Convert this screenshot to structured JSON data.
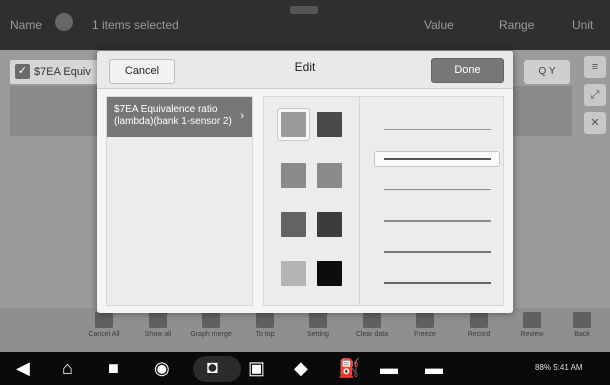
{
  "header": {
    "name_label": "Name",
    "selection_text": "1 items selected",
    "col_value": "Value",
    "col_range": "Range",
    "col_unit": "Unit"
  },
  "background": {
    "item_label": "$7EA Equiv",
    "zoom_label": "Q Y"
  },
  "modal": {
    "title": "Edit",
    "cancel_label": "Cancel",
    "done_label": "Done",
    "list_item_label": "$7EA Equivalence ratio (lambda)(bank 1-sensor 2)",
    "colors": [
      "#9a9a9a",
      "#4a4a4a",
      "#8a8a8a",
      "#8a8a8a",
      "#636363",
      "#3c3c3c",
      "#b4b4b4",
      "#0c0c0c"
    ],
    "selected_color_index": 0,
    "selected_line_index": 1
  },
  "toolbar": {
    "items": [
      {
        "label": "Cancel All",
        "icon": "cancel-all-icon"
      },
      {
        "label": "Show all",
        "icon": "show-all-icon"
      },
      {
        "label": "Graph merge",
        "icon": "graph-merge-icon"
      },
      {
        "label": "To top",
        "icon": "to-top-icon"
      },
      {
        "label": "Setting",
        "icon": "setting-icon"
      },
      {
        "label": "Clear data",
        "icon": "clear-data-icon"
      },
      {
        "label": "Freeze",
        "icon": "freeze-icon"
      },
      {
        "label": "Record",
        "icon": "record-icon"
      },
      {
        "label": "Review",
        "icon": "review-icon"
      },
      {
        "label": "Back",
        "icon": "back-icon"
      }
    ]
  },
  "statusbar": {
    "text": "88% 5:41 AM"
  }
}
